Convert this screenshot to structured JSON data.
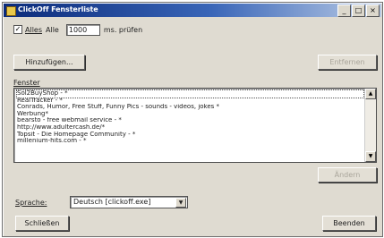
{
  "window": {
    "title": "ClickOff Fensterliste"
  },
  "title_buttons": {
    "minimize": "_",
    "maximize": "□",
    "close": "×"
  },
  "options": {
    "checkbox_checked": true,
    "check_mark": "✓",
    "checkbox_label": "Alles",
    "after_label": "Alle",
    "interval_value": "1000",
    "interval_unit": "ms. prüfen"
  },
  "buttons": {
    "add": "Hinzufügen...",
    "delete": "Entfernen",
    "apply": "Ändern",
    "close": "Schließen",
    "finish": "Beenden"
  },
  "list": {
    "label": "Fenster",
    "items": [
      "Sol2BuyShop - *",
      "RealTracker - *",
      "Conrads, Humor, Free Stuff, Funny Pics - sounds - videos, jokes *",
      "Werbung*",
      "bearsto - free webmail service - *",
      "http://www.adultercash.de/*",
      "Topsit - Die Homepage Community - *",
      "millenium-hits.com - *"
    ]
  },
  "language": {
    "label": "Sprache:",
    "value": "Deutsch [clickoff.exe]"
  },
  "icons": {
    "scroll_up": "▲",
    "scroll_down": "▼",
    "dropdown": "▼"
  }
}
